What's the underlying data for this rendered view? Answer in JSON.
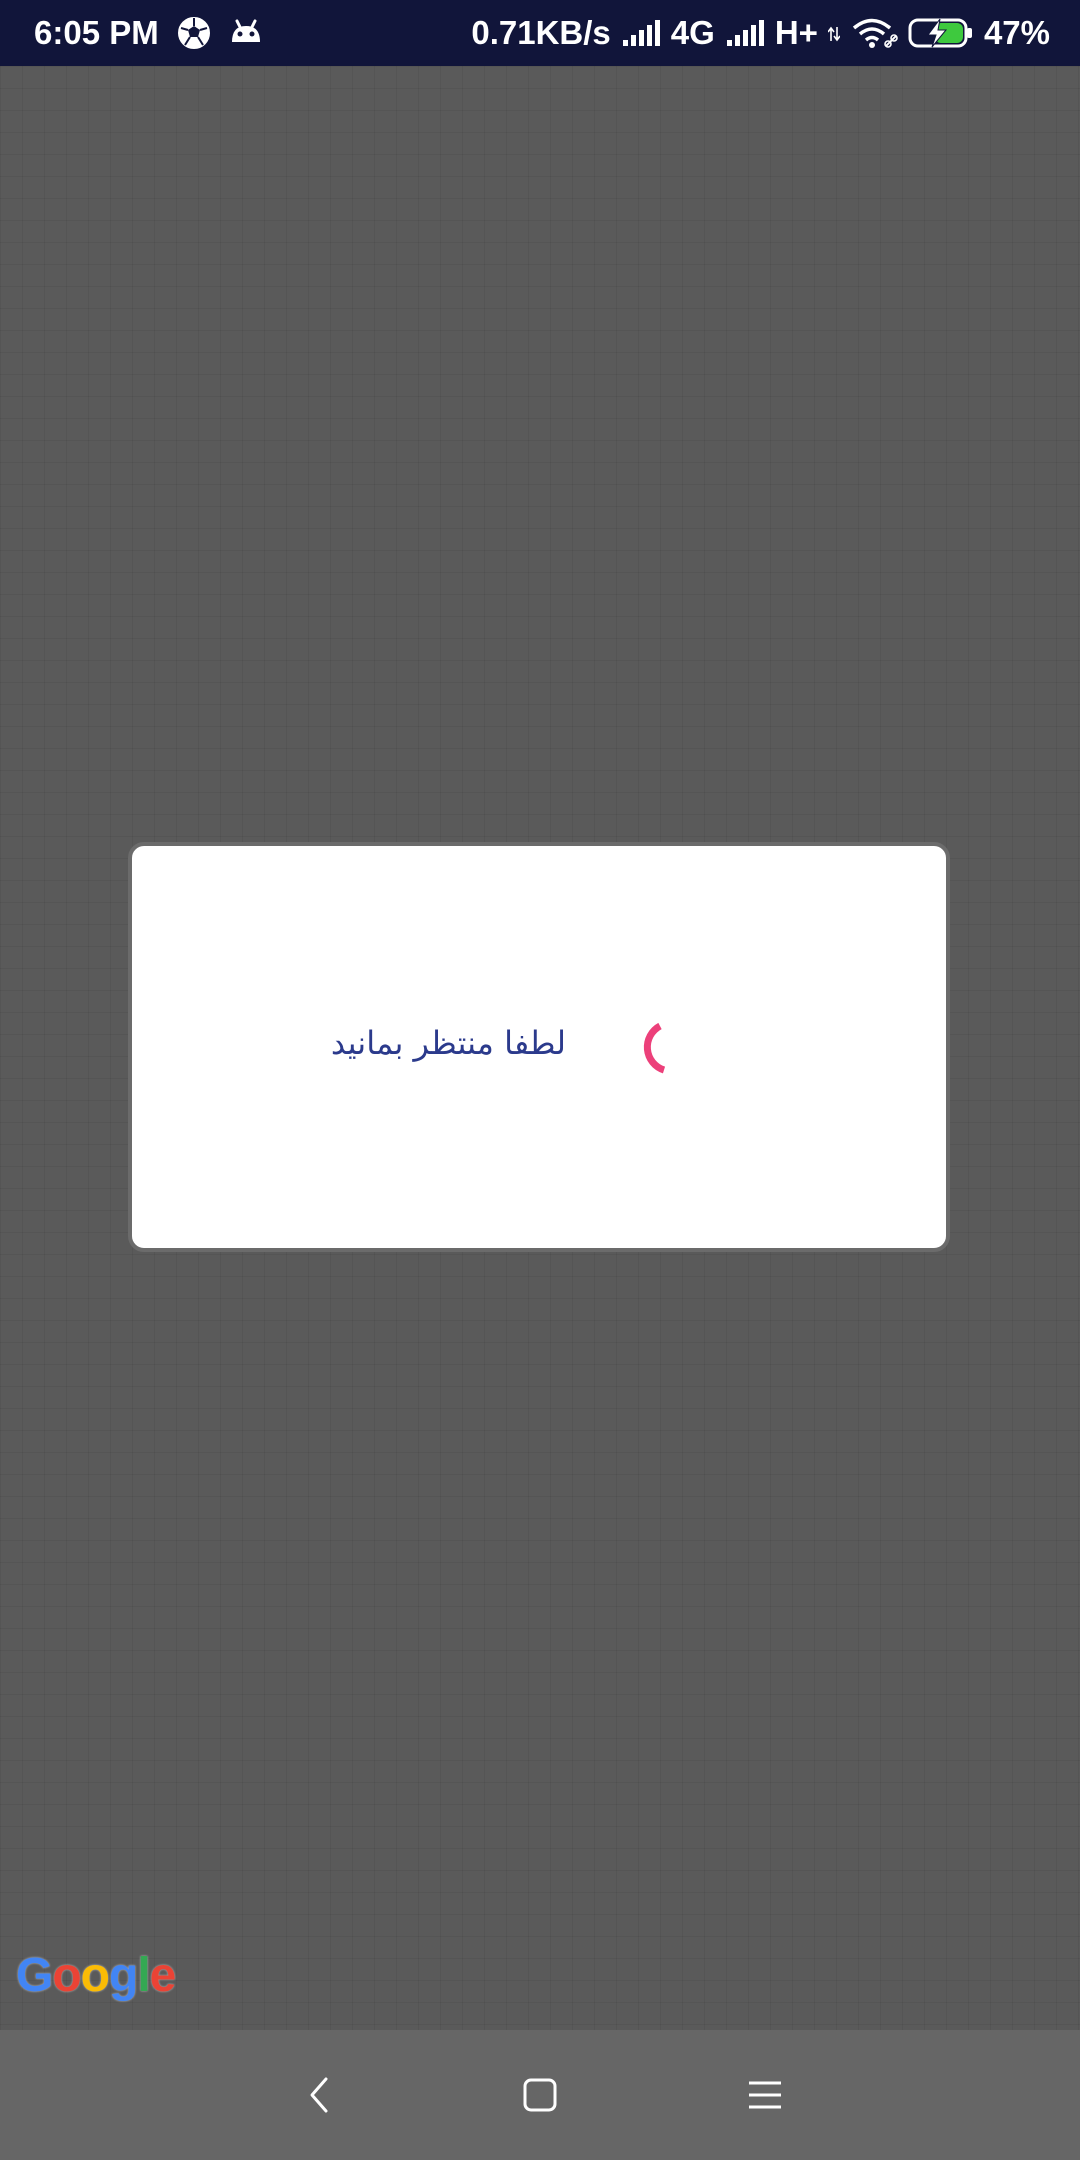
{
  "status_bar": {
    "time": "6:05 PM",
    "notification_icons": [
      "soccer-ball-icon",
      "android-debug-icon"
    ],
    "network_speed": "0.71KB/s",
    "network_type_1": "4G",
    "network_type_2": "H+",
    "battery_percent": "47%",
    "battery_level": 0.47,
    "battery_charging": true,
    "colors": {
      "background": "#11153a",
      "battery_fill": "#3ec93e"
    }
  },
  "map": {
    "attribution": "Google",
    "background_color": "#5a5a5a"
  },
  "dialog": {
    "message": "لطفا منتظر بمانید",
    "spinner_color": "#ec407a",
    "text_color": "#2b3a8c"
  },
  "nav_bar": {
    "buttons": [
      "back-icon",
      "home-icon",
      "menu-icon"
    ]
  }
}
